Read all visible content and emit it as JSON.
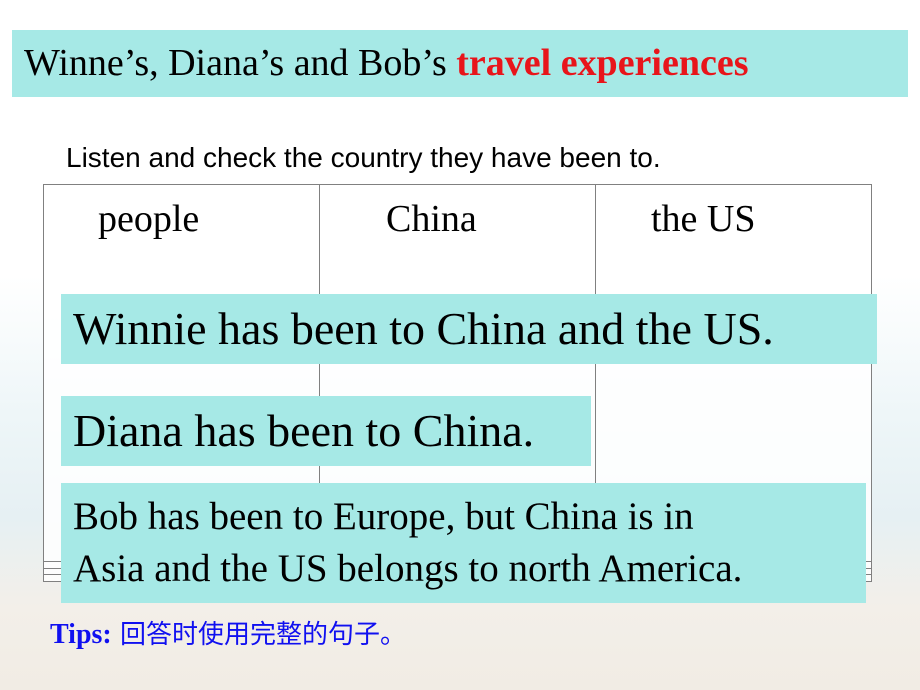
{
  "title": {
    "plain": "Winne’s, Diana’s and Bob’s ",
    "highlight": "travel experiences",
    "highlight_color": "#e8151b",
    "bg_color": "#a6e9e6"
  },
  "instruction": "Listen and check the country they have been to.",
  "table": {
    "headers": [
      "people",
      "China",
      "the US"
    ],
    "rows": [
      [
        "",
        "",
        ""
      ],
      [
        "",
        "",
        ""
      ],
      [
        "",
        "",
        ""
      ]
    ]
  },
  "answers": {
    "winnie": "Winnie has been to China and the US.",
    "diana": "Diana has been to China.",
    "bob_line1": "Bob has been to Europe, but China is in",
    "bob_line2": "Asia and the US belongs to north America."
  },
  "tips": {
    "label": "Tips:",
    "text": " 回答时使用完整的句子。",
    "color": "#1010f0"
  }
}
